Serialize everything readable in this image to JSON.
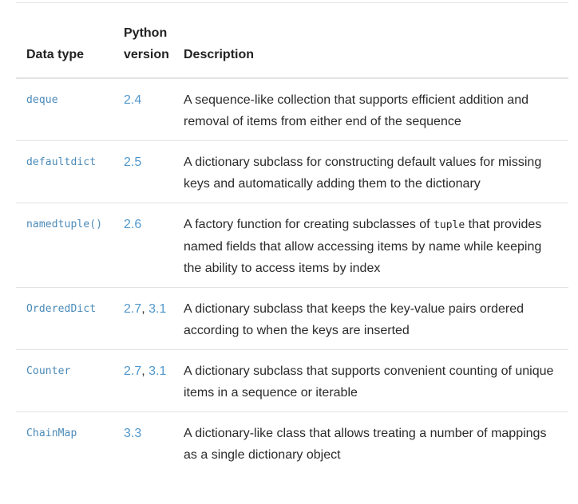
{
  "table": {
    "headers": {
      "type": "Data type",
      "version_line1": "Python",
      "version_line2": "version",
      "description": "Description"
    },
    "rows": [
      {
        "type": "deque",
        "versions": [
          "2.4"
        ],
        "desc_pre": "A sequence-like collection that supports efficient addition and removal of items from either end of the sequence",
        "desc_code": "",
        "desc_post": ""
      },
      {
        "type": "defaultdict",
        "versions": [
          "2.5"
        ],
        "desc_pre": "A dictionary subclass for constructing default values for missing keys and automatically adding them to the dictionary",
        "desc_code": "",
        "desc_post": ""
      },
      {
        "type": "namedtuple()",
        "versions": [
          "2.6"
        ],
        "desc_pre": "A factory function for creating subclasses of ",
        "desc_code": "tuple",
        "desc_post": " that provides named fields that allow accessing items by name while keeping the ability to access items by index"
      },
      {
        "type": "OrderedDict",
        "versions": [
          "2.7",
          "3.1"
        ],
        "desc_pre": "A dictionary subclass that keeps the key-value pairs ordered according to when the keys are inserted",
        "desc_code": "",
        "desc_post": ""
      },
      {
        "type": "Counter",
        "versions": [
          "2.7",
          "3.1"
        ],
        "desc_pre": "A dictionary subclass that supports convenient counting of unique items in a sequence or iterable",
        "desc_code": "",
        "desc_post": ""
      },
      {
        "type": "ChainMap",
        "versions": [
          "3.3"
        ],
        "desc_pre": "A dictionary-like class that allows treating a number of mappings as a single dictionary object",
        "desc_code": "",
        "desc_post": ""
      }
    ],
    "version_separator": ", ",
    "colors": {
      "link": "#4f97cd",
      "code_link": "#4a8ab8",
      "text": "#2b2b2b",
      "rule": "#e3e3e3"
    }
  }
}
